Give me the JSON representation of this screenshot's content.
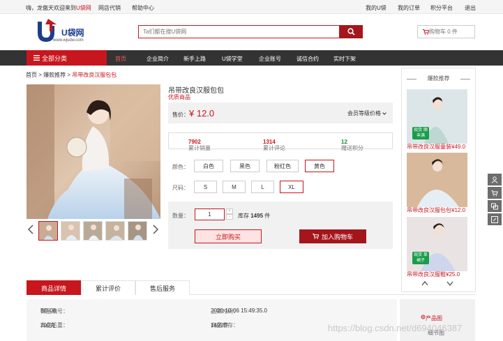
{
  "topbar": {
    "welcome_prefix": "嗨，龙傲天欢迎来到",
    "welcome_brand": "U袋网",
    "links": [
      "网店代销",
      "帮助中心"
    ],
    "right_links": [
      "我的U袋",
      "我的订单",
      "积分平台",
      "退出"
    ]
  },
  "logo": {
    "name": "U袋网",
    "url": "www.wjudw.com"
  },
  "search": {
    "placeholder": "Ta们都在搜U袋网"
  },
  "cart": {
    "label": "购物车 0 件"
  },
  "nav": {
    "category_label": "全部分类",
    "items": [
      "首页",
      "企业简介",
      "新手上路",
      "U袋学堂",
      "企业账号",
      "诚信合约",
      "实时下架"
    ]
  },
  "breadcrumb": {
    "home": "首页",
    "sep": ">",
    "mid": "爆款推荐",
    "current": "吊带改良汉服包包"
  },
  "product": {
    "title": "吊带改良汉服包包",
    "tag": "优质商品",
    "price_label": "售价：",
    "price": "¥ 12.0",
    "member_price": "会员等级价格",
    "stats": {
      "sales_label": "累计销量",
      "sales": "7902",
      "reviews_label": "累计评论",
      "reviews": "1314",
      "points_label": "赠送积分",
      "points": "12"
    },
    "color_label": "颜色：",
    "colors": [
      "白色",
      "黑色",
      "粉红色",
      "黄色"
    ],
    "selected_color": "黄色",
    "size_label": "尺码：",
    "sizes": [
      "S",
      "M",
      "L",
      "XL"
    ],
    "selected_size": "XL",
    "qty_label": "数量：",
    "qty": "1",
    "stock_label": "库存",
    "stock": "1495",
    "stock_unit": "件",
    "buy_now": "立即购买",
    "add_to_cart": "加入购物车"
  },
  "side": {
    "title": "爆款推荐",
    "items": [
      {
        "caption": "吊带改良汉服童装¥49.0",
        "badge": "现货 顺丰满"
      },
      {
        "caption": "吊带改良汉服包包¥12.0",
        "badge": ""
      },
      {
        "caption": "吊带改良汉服鞋¥25.0",
        "badge": "现货 草裙子"
      }
    ]
  },
  "tabs": [
    "商品详情",
    "累计评价",
    "售后服务"
  ],
  "details": {
    "code_label": "商品编号：",
    "code": "BB-08",
    "time_label": "上架时间：",
    "time": "2020-10-06 15:49:35.0",
    "weight_label": "商品毛重：",
    "weight": "200克",
    "stock_label": "商品库存：",
    "stock": "1495件"
  },
  "product_images": {
    "title": "产品图",
    "sub": "细节图"
  },
  "watermark": "https://blog.csdn.net/d694046387",
  "colors": {
    "brand_red": "#c7161d",
    "dark_red": "#a4161b",
    "nav_bg": "#333333",
    "points_green": "#1f8a3a"
  },
  "icons": [
    "search-icon",
    "cart-icon",
    "menu-icon",
    "chevron-left-icon",
    "chevron-right-icon",
    "chevron-down-icon",
    "user-icon",
    "edit-icon"
  ]
}
